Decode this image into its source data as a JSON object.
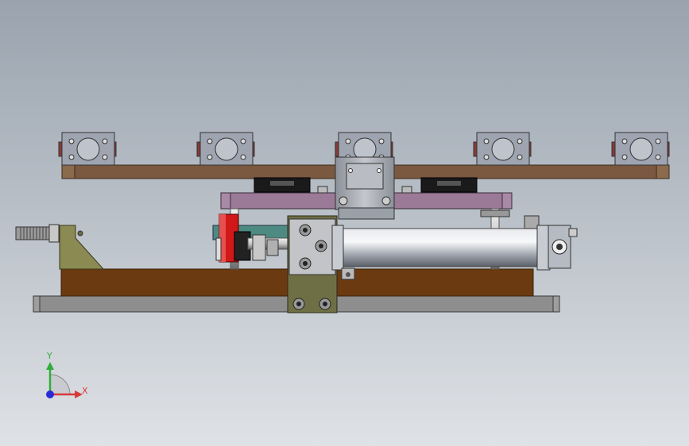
{
  "viewport": {
    "background_top": "#9aa3ae",
    "background_bottom": "#dfe2e6"
  },
  "triad": {
    "x_label": "X",
    "y_label": "Y",
    "x_color": "#d63a3a",
    "y_color": "#2fae3a",
    "z_color": "#2a2ad6"
  },
  "model": {
    "rail_color": "#7b5840",
    "base_color": "#6b3a10",
    "plate_color": "#8a8a8a",
    "carriage_color": "#9a7a96",
    "cylinder_color": "#b8bcc4",
    "stop_color": "#d01818"
  }
}
